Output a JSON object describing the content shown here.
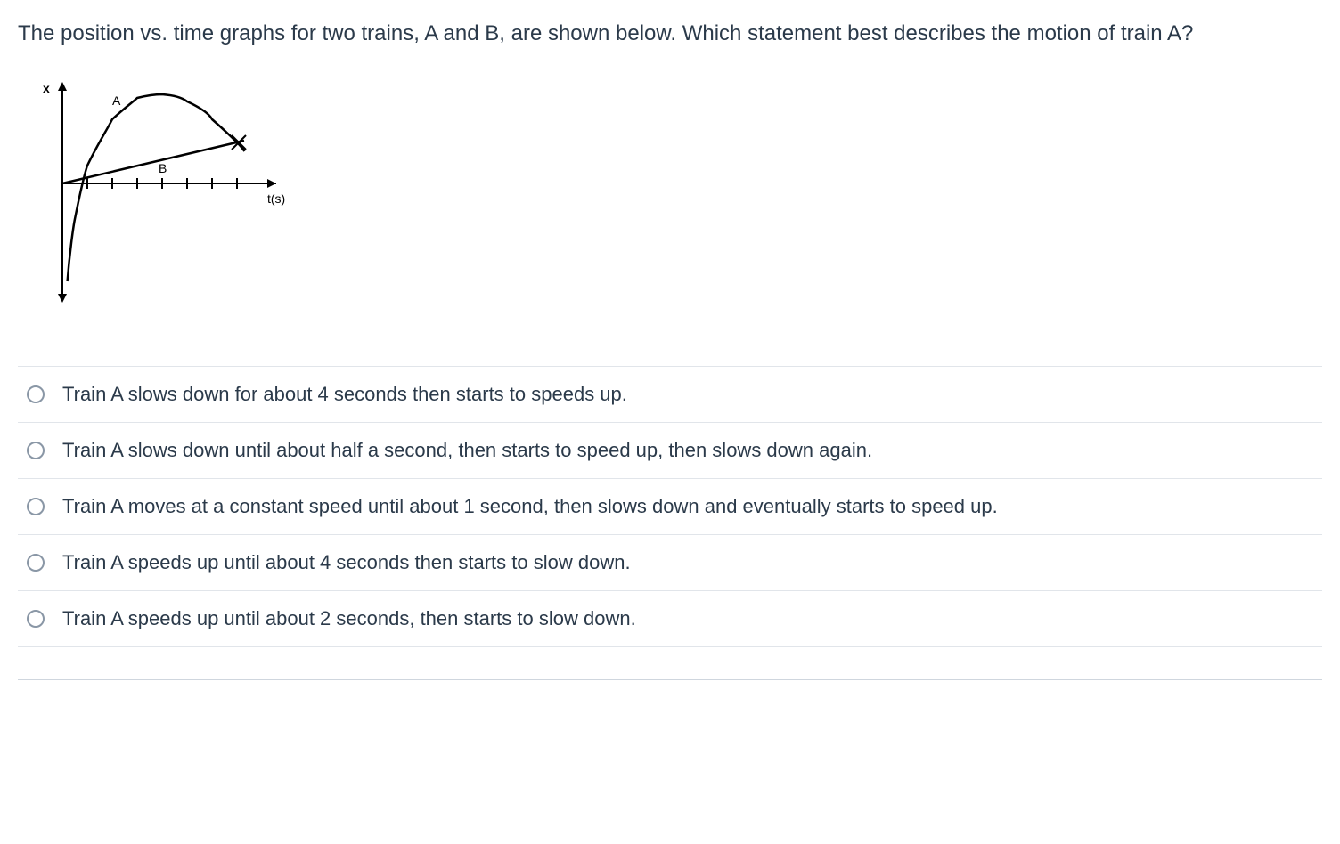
{
  "question": {
    "text": "The position vs. time graphs for two trains, A and B, are shown below.  Which statement best describes the motion of train A?"
  },
  "chart_data": {
    "type": "line",
    "title": "",
    "xlabel": "t(s)",
    "ylabel": "x",
    "xlim": [
      0,
      8
    ],
    "ylim": [
      -6,
      6
    ],
    "ticks_x": [
      1,
      2,
      3,
      4,
      5,
      6,
      7
    ],
    "series": [
      {
        "name": "A",
        "description": "Curved parabola-like path: starts below origin (x negative) at t≈0, rises steeply with decreasing slope, peaks around t≈4 s, then descends and crosses line B near t≈7 s.",
        "x": [
          0.2,
          0.5,
          1,
          2,
          3,
          4,
          5,
          6,
          7,
          7.3
        ],
        "y": [
          -5.5,
          -2.0,
          1.0,
          3.6,
          4.8,
          5.0,
          4.6,
          3.6,
          2.3,
          1.8
        ]
      },
      {
        "name": "B",
        "description": "Straight line from origin with constant positive slope; intersects curve A near t≈7 s.",
        "x": [
          0,
          7.3
        ],
        "y": [
          0,
          2.4
        ]
      }
    ],
    "annotations": [
      {
        "label": "A",
        "x": 2.0,
        "y": 5.0
      },
      {
        "label": "B",
        "x": 4.0,
        "y": 0.6
      }
    ]
  },
  "options": [
    {
      "id": "opt1",
      "text": "Train A slows down for about 4 seconds then starts to speeds up."
    },
    {
      "id": "opt2",
      "text": "Train A slows down until about half a second, then starts to speed up, then slows down again."
    },
    {
      "id": "opt3",
      "text": "Train A moves at a constant speed until about 1 second, then slows down and eventually starts to speed up."
    },
    {
      "id": "opt4",
      "text": "Train A speeds up until about 4 seconds then starts to slow down."
    },
    {
      "id": "opt5",
      "text": "Train A speeds up until about 2 seconds, then starts to slow down."
    }
  ]
}
